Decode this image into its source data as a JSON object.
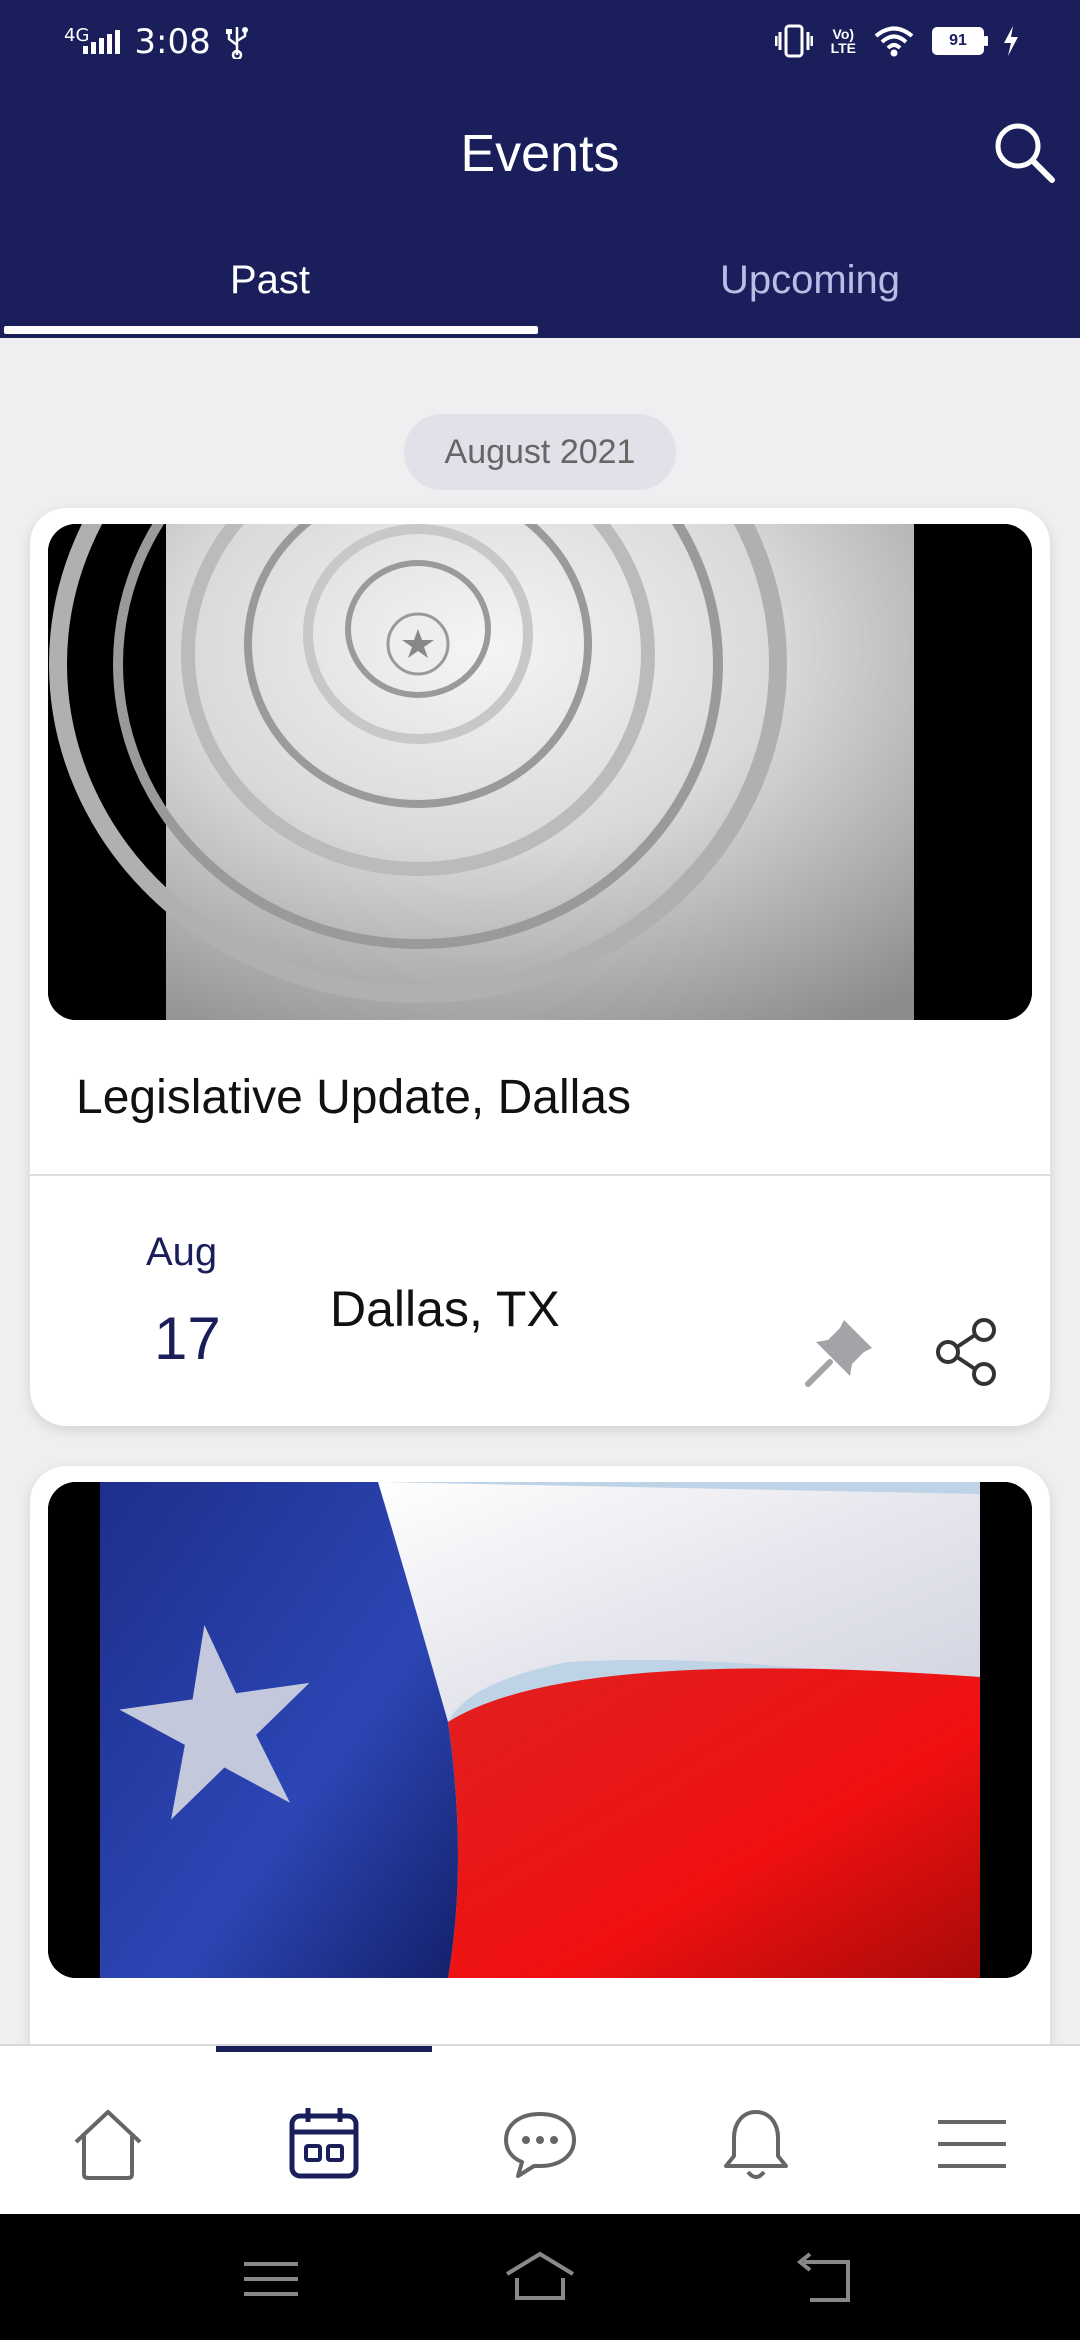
{
  "status_bar": {
    "network": "4G",
    "time": "3:08",
    "volte_top": "Vo)",
    "volte_bottom": "LTE",
    "battery": "91"
  },
  "header": {
    "title": "Events",
    "tabs": [
      {
        "label": "Past",
        "active": true
      },
      {
        "label": "Upcoming",
        "active": false
      }
    ]
  },
  "month_label": "August 2021",
  "events": [
    {
      "title": "Legislative Update, Dallas",
      "month": "Aug",
      "day": "17",
      "location": "Dallas, TX",
      "image": "capitol-dome-photo"
    },
    {
      "title": "",
      "image": "texas-flag-photo"
    }
  ],
  "bottom_nav": {
    "items": [
      "home-icon",
      "calendar-icon",
      "chat-icon",
      "bell-icon",
      "menu-icon"
    ],
    "active_index": 1
  },
  "colors": {
    "brand": "#1a1f5c",
    "tab_inactive": "#b9bde6",
    "background": "#efeff1"
  }
}
